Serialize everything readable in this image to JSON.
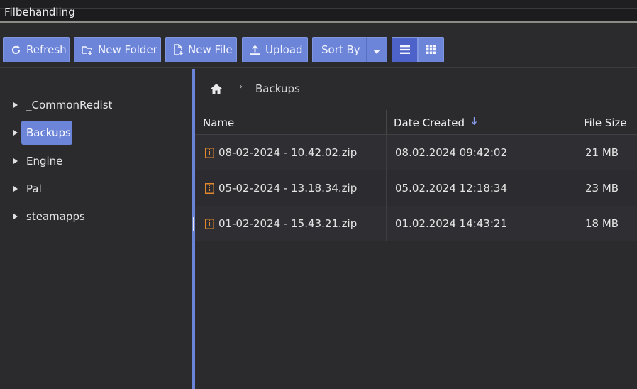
{
  "window": {
    "title": "Filbehandling"
  },
  "toolbar": {
    "refresh_label": "Refresh",
    "new_folder_label": "New Folder",
    "new_file_label": "New File",
    "upload_label": "Upload",
    "sort_by_label": "Sort By"
  },
  "sidebar": {
    "items": [
      {
        "label": "_CommonRedist"
      },
      {
        "label": "Backups"
      },
      {
        "label": "Engine"
      },
      {
        "label": "Pal"
      },
      {
        "label": "steamapps"
      }
    ]
  },
  "breadcrumb": {
    "current": "Backups"
  },
  "table": {
    "headers": {
      "name": "Name",
      "date_created": "Date Created",
      "file_size": "File Size"
    },
    "rows": [
      {
        "name": "08-02-2024 - 10.42.02.zip",
        "date": "08.02.2024 09:42:02",
        "size": "21 MB"
      },
      {
        "name": "05-02-2024 - 13.18.34.zip",
        "date": "05.02.2024 12:18:34",
        "size": "23 MB"
      },
      {
        "name": "01-02-2024 - 15.43.21.zip",
        "date": "01.02.2024 14:43:21",
        "size": "18 MB"
      }
    ]
  },
  "colors": {
    "accent": "#6d85d8",
    "accent_active": "#4d63c9",
    "zip_icon": "#e0892e",
    "background": "#2b2b2e"
  },
  "icons": {
    "refresh": "refresh-icon",
    "new_folder": "new-folder-icon",
    "new_file": "new-file-icon",
    "upload": "upload-icon",
    "home": "home-icon",
    "zip": "zip-file-icon"
  }
}
